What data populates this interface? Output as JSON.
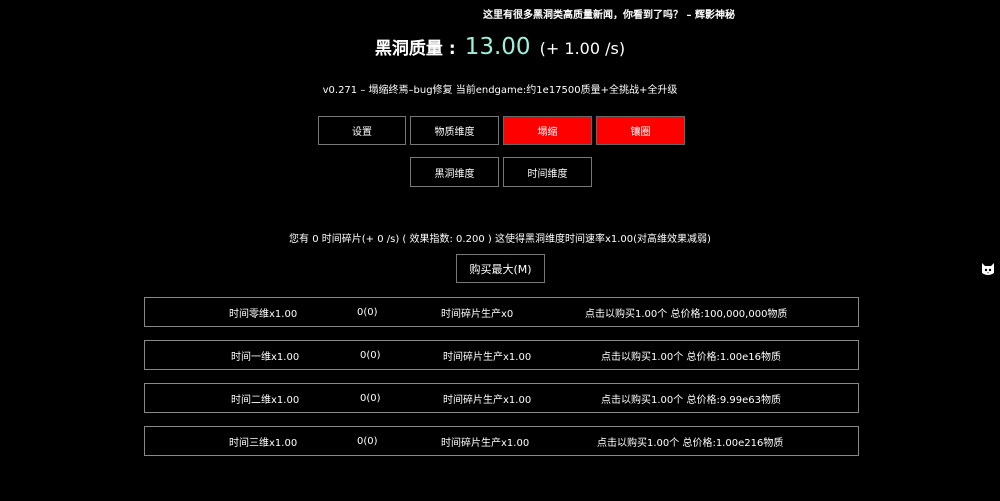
{
  "news": "这里有很多黑洞类高质量新闻，你看到了吗？ – 辉影神秘",
  "header": {
    "mass_label": "黑洞质量 :",
    "mass_value": "13.00",
    "mass_rate": "(+ 1.00 /s)"
  },
  "version": "v0.271 – 塌缩终焉–bug修复 当前endgame:约1e17500质量+全挑战+全升级",
  "tabs": [
    {
      "label": "设置",
      "active": false
    },
    {
      "label": "物质维度",
      "active": false
    },
    {
      "label": "塌缩",
      "active": true
    },
    {
      "label": "镶圈",
      "active": true
    }
  ],
  "subtabs": [
    {
      "label": "黑洞维度"
    },
    {
      "label": "时间维度"
    }
  ],
  "info_text": "您有 0 时间碎片(+ 0 /s) ( 效果指数: 0.200 ) 这使得黑洞维度时间速率x1.00(对高维效果减弱)",
  "buy_max_label": "购买最大(M)",
  "dimensions": [
    {
      "name": "时间零维x1.00",
      "amount": "0(0)",
      "production": "时间碎片生产x0",
      "cost": "点击以购买1.00个 总价格:100,000,000物质"
    },
    {
      "name": "时间一维x1.00",
      "amount": "0(0)",
      "production": "时间碎片生产x1.00",
      "cost": "点击以购买1.00个 总价格:1.00e16物质"
    },
    {
      "name": "时间二维x1.00",
      "amount": "0(0)",
      "production": "时间碎片生产x1.00",
      "cost": "点击以购买1.00个 总价格:9.99e63物质"
    },
    {
      "name": "时间三维x1.00",
      "amount": "0(0)",
      "production": "时间碎片生产x1.00",
      "cost": "点击以购买1.00个 总价格:1.00e216物质"
    }
  ],
  "colors": {
    "background": "#000000",
    "active_tab": "#ff0000",
    "mass_value": "#9ef0dc",
    "border": "#888888"
  },
  "icons": {
    "side": "cat-face-icon"
  }
}
